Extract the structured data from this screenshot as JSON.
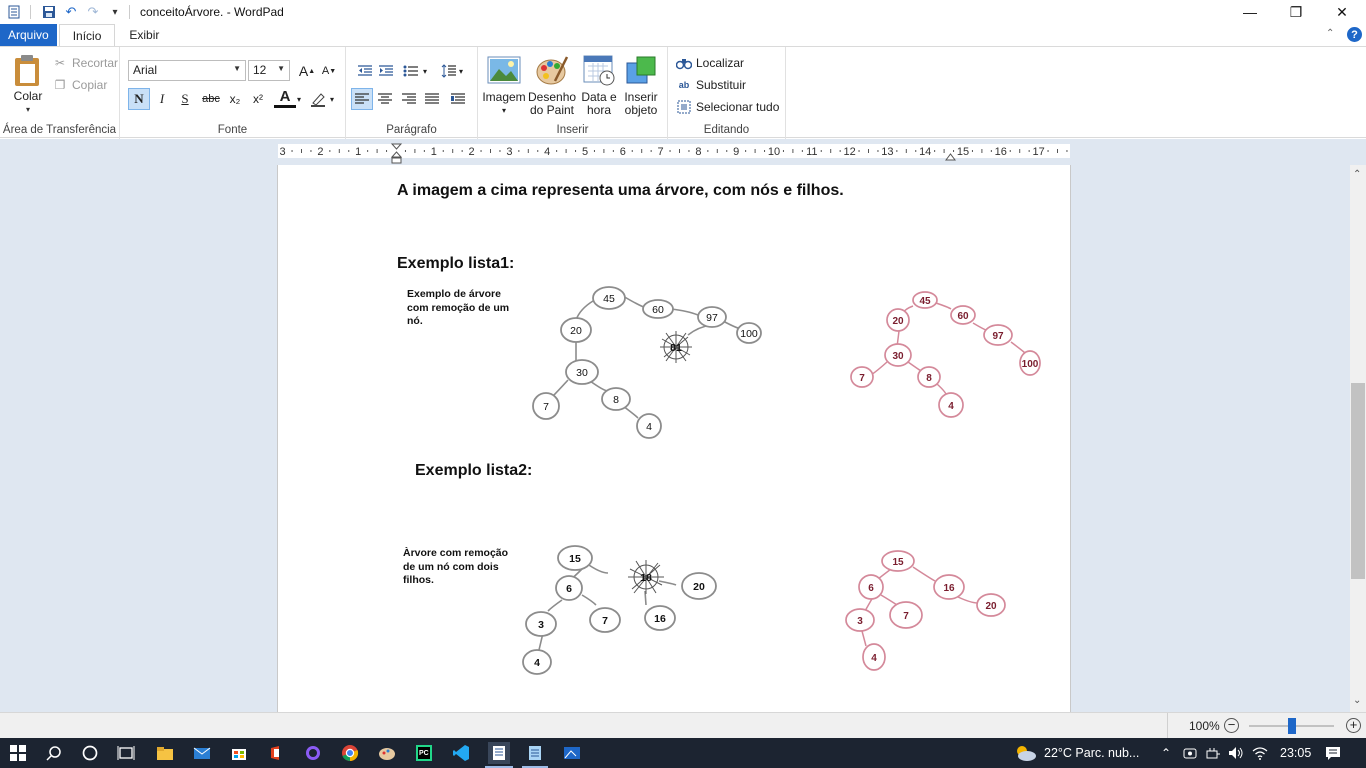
{
  "window": {
    "title": "conceitoÁrvore. - WordPad",
    "controls": {
      "minimize": "—",
      "maximize": "❐",
      "close": "✕"
    }
  },
  "tabs": [
    {
      "label": "Arquivo"
    },
    {
      "label": "Início"
    },
    {
      "label": "Exibir"
    }
  ],
  "ribbon": {
    "clipboard": {
      "paste": "Colar",
      "cut": "Recortar",
      "copy": "Copiar",
      "label": "Área de Transferência"
    },
    "font": {
      "family": "Arial",
      "size": "12",
      "label": "Fonte",
      "grow": "A",
      "shrink": "A",
      "bold": "N",
      "italic": "I",
      "underline": "S",
      "strike": "abc",
      "subscript": "x₂",
      "superscript": "x²",
      "color": "A"
    },
    "paragraph": {
      "label": "Parágrafo"
    },
    "insert": {
      "label": "Inserir",
      "image": "Imagem",
      "paint_line1": "Desenho",
      "paint_line2": "do Paint",
      "datetime_line1": "Data e",
      "datetime_line2": "hora",
      "object_line1": "Inserir",
      "object_line2": "objeto"
    },
    "editing": {
      "label": "Editando",
      "find": "Localizar",
      "replace": "Substituir",
      "select_all": "Selecionar tudo"
    }
  },
  "ruler": {
    "labels": [
      "3",
      "2",
      "1",
      "1",
      "2",
      "3",
      "4",
      "5",
      "6",
      "7",
      "8",
      "9",
      "10",
      "11",
      "12",
      "13",
      "14",
      "15",
      "16",
      "17"
    ]
  },
  "document": {
    "intro": "A imagem a cima representa uma árvore, com nós e filhos.",
    "example1": {
      "heading": "Exemplo lista1:",
      "note": [
        "Exemplo de árvore",
        "com remoção de um",
        "nó."
      ],
      "before_nodes": [
        "45",
        "60",
        "97",
        "100",
        "20",
        "81",
        "30",
        "8",
        "7",
        "4"
      ],
      "after_nodes": [
        "45",
        "60",
        "20",
        "97",
        "30",
        "100",
        "7",
        "8",
        "4"
      ]
    },
    "example2": {
      "heading": "Exemplo lista2:",
      "note": [
        "Àrvore com remoção",
        "de um nó com dois",
        "filhos."
      ],
      "before_nodes": [
        "15",
        "18",
        "20",
        "6",
        "7",
        "16",
        "3",
        "4"
      ],
      "after_nodes": [
        "15",
        "6",
        "16",
        "7",
        "20",
        "3",
        "4"
      ]
    },
    "colors": {
      "tree_gray": "#8c8c8c",
      "tree_pink": "#d4899a",
      "tree_pink_text": "#7a1d2e"
    }
  },
  "status": {
    "zoom": "100%"
  },
  "taskbar": {
    "weather": "22°C  Parc. nub...",
    "time": "23:05"
  }
}
